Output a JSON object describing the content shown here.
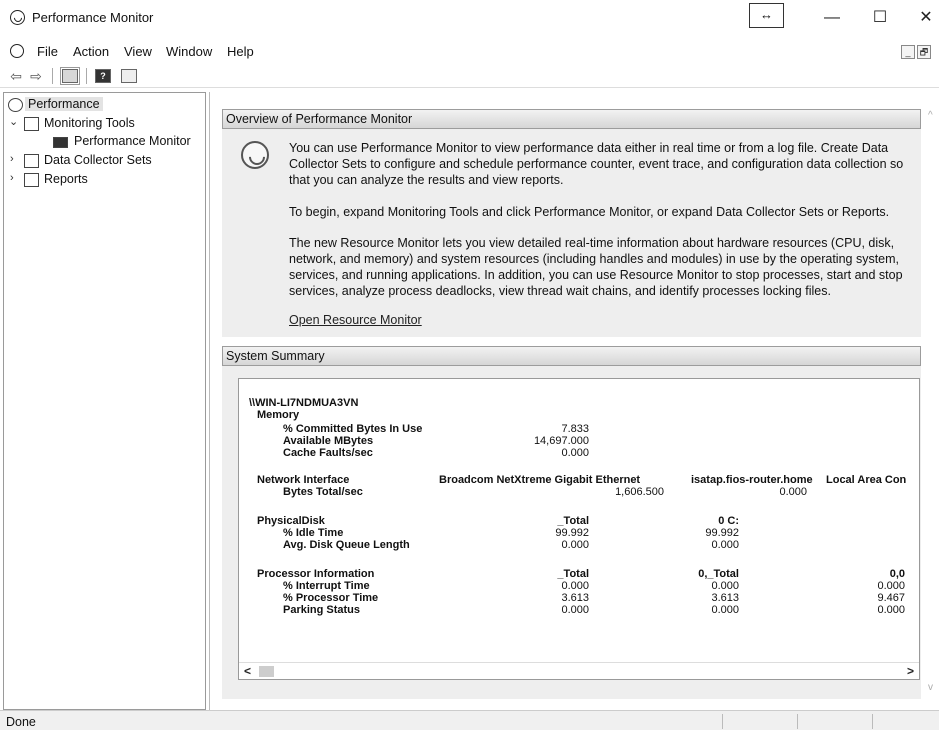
{
  "window": {
    "title": "Performance Monitor",
    "resize_glyph": "↔",
    "minimize_glyph": "—",
    "maximize_glyph": "☐",
    "close_glyph": "✕"
  },
  "menu": {
    "items": [
      "File",
      "Action",
      "View",
      "Window",
      "Help"
    ],
    "mdi_minimize": "_",
    "mdi_restore": "🗗"
  },
  "toolbar": {
    "back_glyph": "⇦",
    "forward_glyph": "⇨",
    "help_glyph": "?"
  },
  "tree": {
    "root": "Performance",
    "monitoring_tools": "Monitoring Tools",
    "performance_monitor": "Performance Monitor",
    "data_collector_sets": "Data Collector Sets",
    "reports": "Reports",
    "expanded_glyph": "⌄",
    "collapsed_glyph": "›"
  },
  "overview": {
    "header": "Overview of Performance Monitor",
    "para1": "You can use Performance Monitor to view performance data either in real time or from a log file. Create Data Collector Sets to configure and schedule performance counter, event trace, and configuration data collection so that you can analyze the results and view reports.",
    "para2": "To begin, expand Monitoring Tools and click Performance Monitor, or expand Data Collector Sets or Reports.",
    "para3": "The new Resource Monitor lets you view detailed real-time information about hardware resources (CPU, disk, network, and memory) and system resources (including handles and modules) in use by the operating system, services, and running applications. In addition, you can use Resource Monitor to stop processes, start and stop services, analyze process deadlocks, view thread wait chains, and identify processes locking files.",
    "link": "Open Resource Monitor"
  },
  "summary": {
    "header": "System Summary",
    "machine": "\\\\WIN-LI7NDMUA3VN",
    "memory": {
      "title": "Memory",
      "rows": [
        {
          "label": "% Committed Bytes In Use",
          "value": "7.833"
        },
        {
          "label": "Available MBytes",
          "value": "14,697.000"
        },
        {
          "label": "Cache Faults/sec",
          "value": "0.000"
        }
      ]
    },
    "network": {
      "title": "Network Interface",
      "instances": [
        "Broadcom NetXtreme Gigabit Ethernet",
        "isatap.fios-router.home",
        "Local Area Con"
      ],
      "rows": [
        {
          "label": "Bytes Total/sec",
          "values": [
            "1,606.500",
            "0.000"
          ]
        }
      ]
    },
    "disk": {
      "title": "PhysicalDisk",
      "instances": [
        "_Total",
        "0 C:"
      ],
      "rows": [
        {
          "label": "% Idle Time",
          "values": [
            "99.992",
            "99.992"
          ]
        },
        {
          "label": "Avg. Disk Queue Length",
          "values": [
            "0.000",
            "0.000"
          ]
        }
      ]
    },
    "processor": {
      "title": "Processor Information",
      "instances": [
        "_Total",
        "0,_Total",
        "0,0"
      ],
      "rows": [
        {
          "label": "% Interrupt Time",
          "values": [
            "0.000",
            "0.000",
            "0.000"
          ]
        },
        {
          "label": "% Processor Time",
          "values": [
            "3.613",
            "3.613",
            "9.467"
          ]
        },
        {
          "label": "Parking Status",
          "values": [
            "0.000",
            "0.000",
            "0.000"
          ]
        }
      ]
    },
    "scroll_left": "<",
    "scroll_right": ">"
  },
  "status": {
    "text": "Done"
  }
}
